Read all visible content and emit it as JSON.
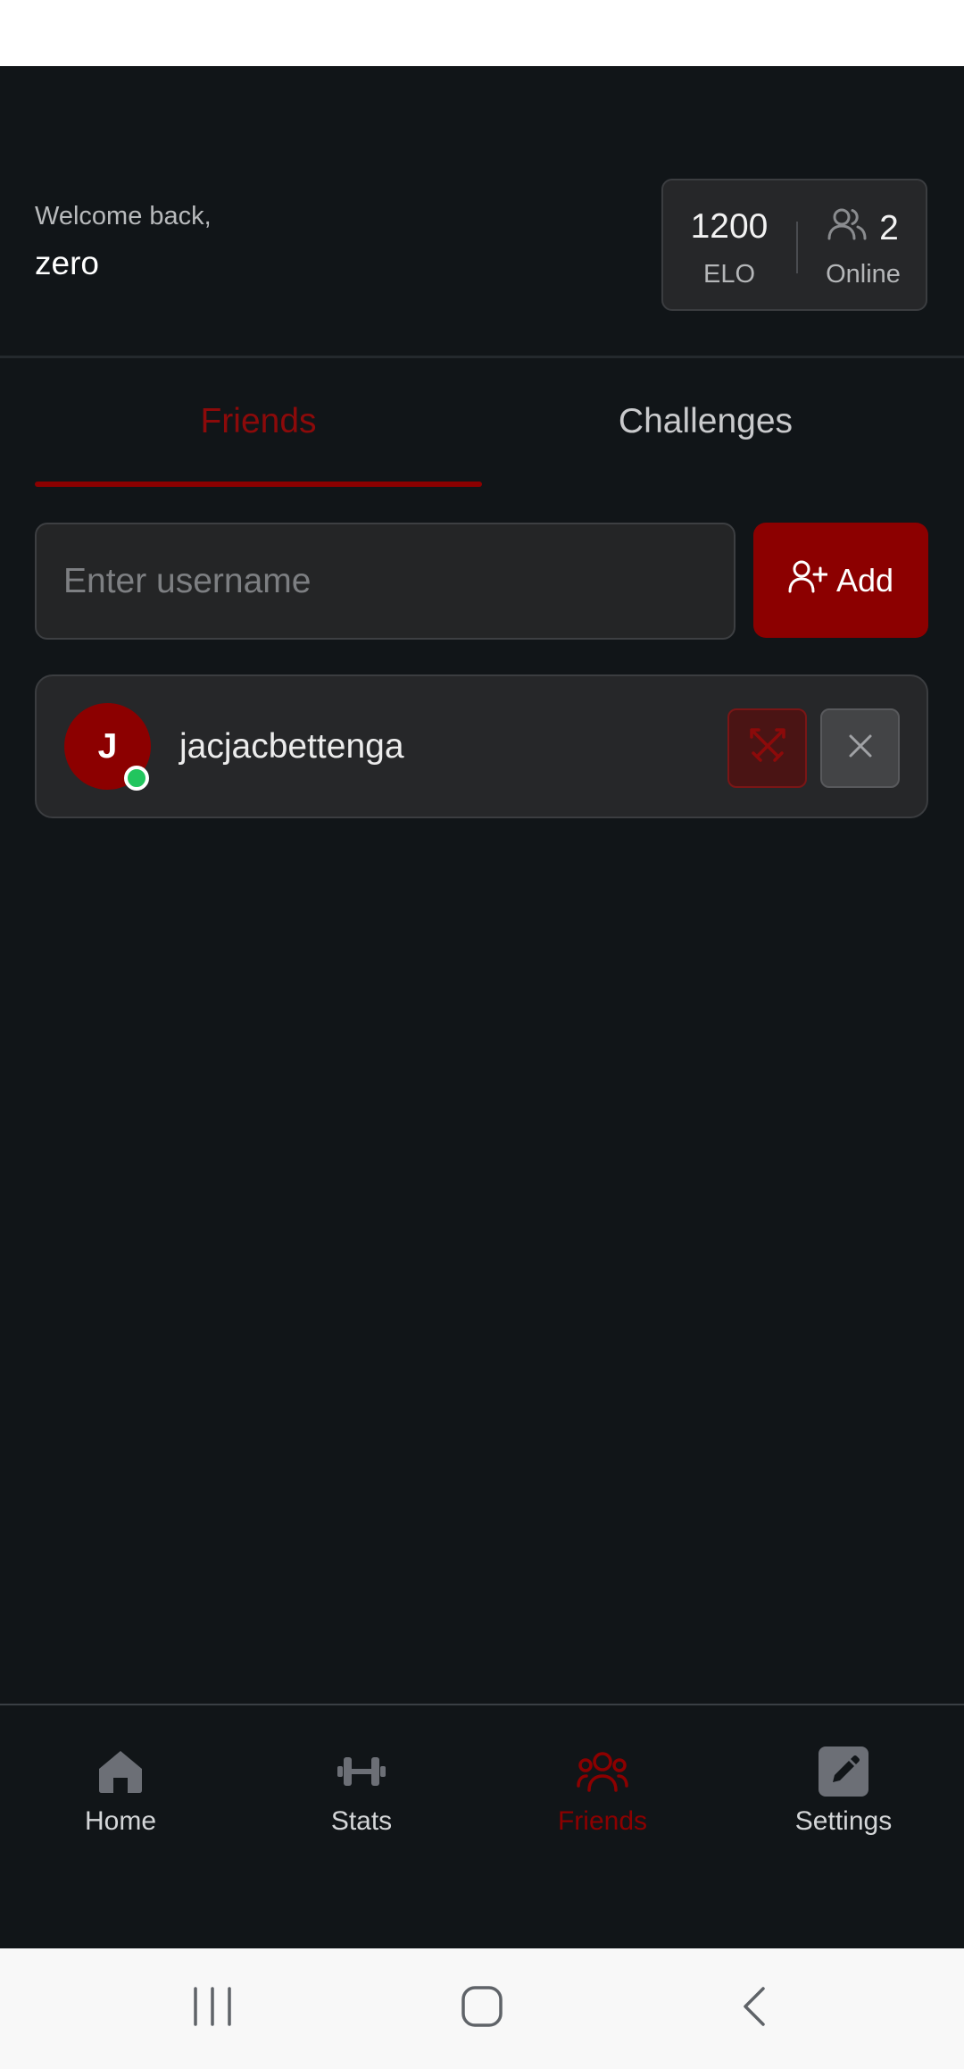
{
  "header": {
    "welcome_text": "Welcome back,",
    "username": "zero"
  },
  "stats": {
    "elo_value": "1200",
    "elo_label": "ELO",
    "online_value": "2",
    "online_label": "Online"
  },
  "tabs": [
    {
      "label": "Friends",
      "active": true
    },
    {
      "label": "Challenges",
      "active": false
    }
  ],
  "add_friend": {
    "placeholder": "Enter username",
    "button_label": "Add"
  },
  "friends": [
    {
      "initial": "J",
      "username": "jacjacbettenga",
      "online": true
    }
  ],
  "bottom_nav": [
    {
      "label": "Home",
      "icon": "home-icon",
      "active": false
    },
    {
      "label": "Stats",
      "icon": "dumbbell-icon",
      "active": false
    },
    {
      "label": "Friends",
      "icon": "users-icon",
      "active": true
    },
    {
      "label": "Settings",
      "icon": "edit-icon",
      "active": false
    }
  ],
  "colors": {
    "accent": "#8c0000",
    "background": "#111518",
    "card": "#262729",
    "online": "#22c55e"
  }
}
